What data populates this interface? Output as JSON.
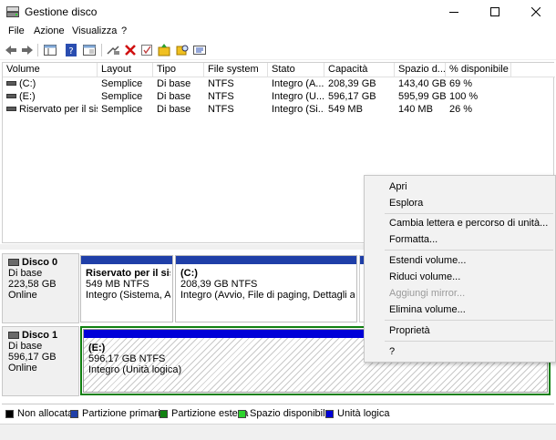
{
  "window": {
    "title": "Gestione disco"
  },
  "menu": [
    "File",
    "Azione",
    "Visualizza",
    "?"
  ],
  "volumes": {
    "columns": [
      "Volume",
      "Layout",
      "Tipo",
      "File system",
      "Stato",
      "Capacità",
      "Spazio d...",
      "% disponibile"
    ],
    "rows": [
      [
        "(C:)",
        "Semplice",
        "Di base",
        "NTFS",
        "Integro (A...",
        "208,39 GB",
        "143,40 GB",
        "69 %"
      ],
      [
        "(E:)",
        "Semplice",
        "Di base",
        "NTFS",
        "Integro (U...",
        "596,17 GB",
        "595,99 GB",
        "100 %"
      ],
      [
        "Riservato per il sist...",
        "Semplice",
        "Di base",
        "NTFS",
        "Integro (Si...",
        "549 MB",
        "140 MB",
        "26 %"
      ]
    ]
  },
  "disks": [
    {
      "name": "Disco 0",
      "type": "Di base",
      "size": "223,58 GB",
      "status": "Online",
      "partitions": [
        {
          "name": "Riservato per il siste",
          "size": "549 MB NTFS",
          "status": "Integro (Sistema, Attiv"
        },
        {
          "name": "(C:)",
          "size": "208,39 GB NTFS",
          "status": "Integro (Avvio, File di paging, Dettagli arresto"
        }
      ]
    },
    {
      "name": "Disco 1",
      "type": "Di base",
      "size": "596,17 GB",
      "status": "Online",
      "partitions": [
        {
          "name": "(E:)",
          "size": "596,17 GB NTFS",
          "status": "Integro (Unità logica)"
        }
      ]
    }
  ],
  "legend": [
    {
      "label": "Non allocata",
      "color": "#000000"
    },
    {
      "label": "Partizione primaria",
      "color": "#1f3fa8"
    },
    {
      "label": "Partizione estesa",
      "color": "#108010"
    },
    {
      "label": "Spazio disponibile",
      "color": "#2ed42e"
    },
    {
      "label": "Unità logica",
      "color": "#0000d8"
    }
  ],
  "context_menu": {
    "items": [
      "Apri",
      "Esplora",
      "Cambia lettera e percorso di unità...",
      "Formatta...",
      "Estendi volume...",
      "Riduci volume...",
      "Aggiungi mirror...",
      "Elimina volume...",
      "Proprietà",
      "?"
    ]
  },
  "colors": {
    "primary_bar": "#1f3fa8",
    "logical_bar": "#0000d8",
    "extended_border": "#108010"
  }
}
